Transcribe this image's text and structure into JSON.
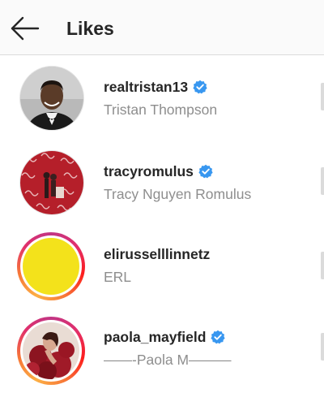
{
  "header": {
    "title": "Likes",
    "back_icon": "arrow-left-icon"
  },
  "likes": [
    {
      "username": "realtristan13",
      "full_name": "Tristan Thompson",
      "verified": true,
      "story_ring": false
    },
    {
      "username": "tracyromulus",
      "full_name": "Tracy Nguyen Romulus",
      "verified": true,
      "story_ring": false
    },
    {
      "username": "elirusselllinnetz",
      "full_name": "ERL",
      "verified": false,
      "story_ring": true
    },
    {
      "username": "paola_mayfield",
      "full_name": "——-Paola M———",
      "verified": true,
      "story_ring": true
    }
  ],
  "colors": {
    "verified_badge": "#3897f0",
    "username": "#262626",
    "secondary_text": "#8e8e8e",
    "story_ring_start": "#c13584",
    "story_ring_end": "#fcaf45"
  }
}
